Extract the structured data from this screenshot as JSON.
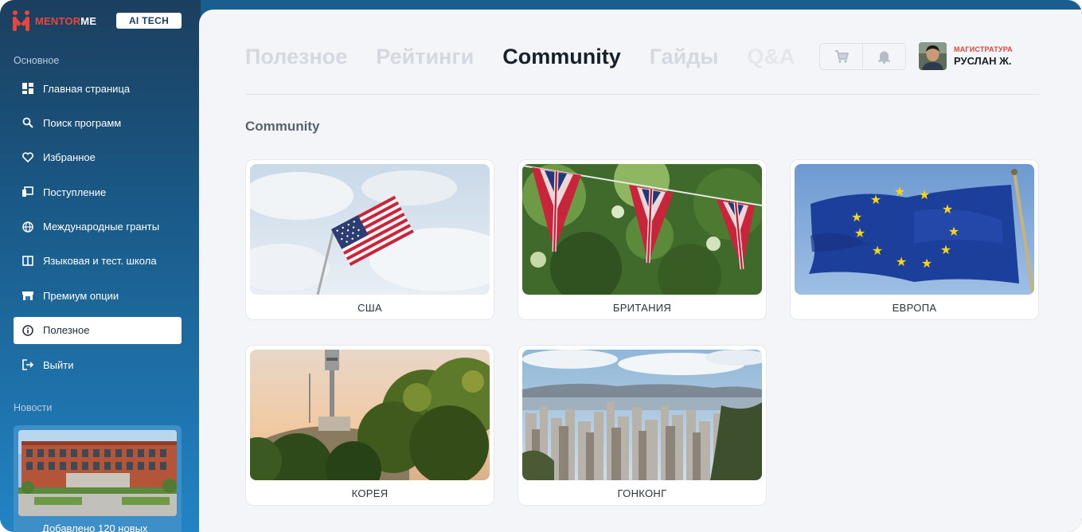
{
  "brand": {
    "name_part1": "MENTOR",
    "name_part2": "ME",
    "badge": "AI TECH",
    "accent_color": "#e8463c"
  },
  "sidebar": {
    "section_main": "Основное",
    "items": [
      {
        "label": "Главная страница",
        "icon": "dashboard-icon"
      },
      {
        "label": "Поиск программ",
        "icon": "search-icon"
      },
      {
        "label": "Избранное",
        "icon": "heart-icon"
      },
      {
        "label": "Поступление",
        "icon": "admission-icon"
      },
      {
        "label": "Международные гранты",
        "icon": "globe-icon"
      },
      {
        "label": "Языковая и тест. школа",
        "icon": "book-icon"
      },
      {
        "label": "Премиум опции",
        "icon": "store-icon"
      },
      {
        "label": "Полезное",
        "icon": "info-icon",
        "active": true
      },
      {
        "label": "Выйти",
        "icon": "logout-icon"
      }
    ],
    "section_news": "Новости",
    "news_text": "Добавлено 120 новых"
  },
  "header": {
    "tabs": [
      {
        "label": "Полезное"
      },
      {
        "label": "Рейтинги"
      },
      {
        "label": "Community",
        "active": true
      },
      {
        "label": "Гайды"
      },
      {
        "label": "Q&A"
      }
    ],
    "user": {
      "role": "МАГИСТРАТУРА",
      "name": "РУСЛАН Ж."
    }
  },
  "main": {
    "title": "Community",
    "cards": [
      {
        "label": "США"
      },
      {
        "label": "БРИТАНИЯ"
      },
      {
        "label": "ЕВРОПА"
      },
      {
        "label": "КОРЕЯ"
      },
      {
        "label": "ГОНКОНГ"
      }
    ]
  }
}
